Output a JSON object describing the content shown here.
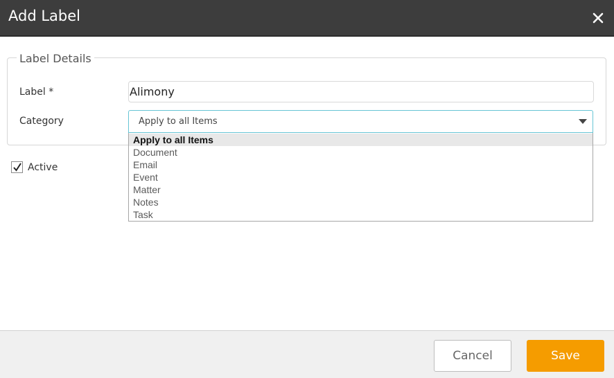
{
  "dialog": {
    "title": "Add Label",
    "close_icon": "close-icon"
  },
  "form": {
    "section_title": "Label Details",
    "label_field": {
      "label": "Label *",
      "value": "Alimony"
    },
    "category_field": {
      "label": "Category",
      "selected": "Apply to all Items",
      "caret_icon": "caret-down-icon",
      "options": [
        "Apply to all Items",
        "Document",
        "Email",
        "Event",
        "Matter",
        "Notes",
        "Task"
      ]
    },
    "active": {
      "label": "Active",
      "checked": true
    }
  },
  "footer": {
    "cancel_label": "Cancel",
    "save_label": "Save"
  },
  "colors": {
    "titlebar": "#3d3d3d",
    "accent": "#f59c00",
    "select_focus_border": "#66c4d4"
  }
}
